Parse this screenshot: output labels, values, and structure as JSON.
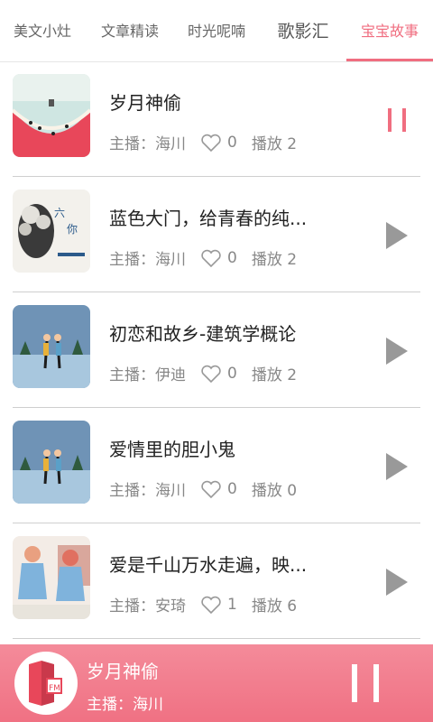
{
  "tabs": [
    {
      "label": "美文小灶"
    },
    {
      "label": "文章精读"
    },
    {
      "label": "时光呢喃"
    },
    {
      "label": "歌影汇"
    },
    {
      "label": "宝宝故事"
    }
  ],
  "active_tab": "宝宝故事",
  "likes_label": "",
  "items": [
    {
      "title": "岁月神偷",
      "host": "主播：海川",
      "likes": "0",
      "plays": "播放 2",
      "state": "pause-icon"
    },
    {
      "title": "蓝色大门，给青春的纯...",
      "host": "主播：海川",
      "likes": "0",
      "plays": "播放 2",
      "state": "play-icon"
    },
    {
      "title": "初恋和故乡-建筑学概论",
      "host": "主播：伊迪",
      "likes": "0",
      "plays": "播放 2",
      "state": "play-icon"
    },
    {
      "title": "爱情里的胆小鬼",
      "host": "主播：海川",
      "likes": "0",
      "plays": "播放 0",
      "state": "play-icon"
    },
    {
      "title": "爱是千山万水走遍，映...",
      "host": "主播：安琦",
      "likes": "1",
      "plays": "播放 6",
      "state": "play-icon"
    }
  ],
  "player": {
    "title": "岁月神偷",
    "host": "主播：海川"
  },
  "colors": {
    "accent": "#f06e80",
    "player_bg": "#f07f90",
    "control": "#999999"
  }
}
